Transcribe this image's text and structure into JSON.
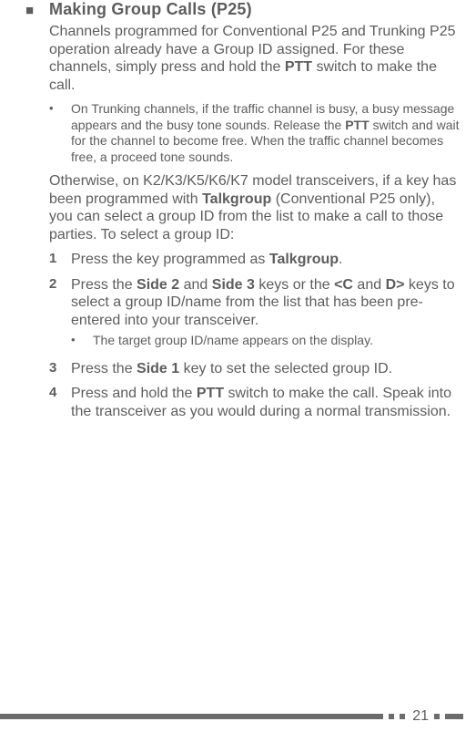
{
  "title": "Making Group Calls (P25)",
  "para1_a": "Channels programmed for Conventional P25 and Trunking P25 operation already have a Group ID assigned.  For these channels, simply press and hold the ",
  "para1_b": "PTT",
  "para1_c": " switch to make the call.",
  "bullet1_a": "On Trunking channels, if the traffic channel is busy, a busy message appears and the busy tone sounds.  Release the ",
  "bullet1_b": "PTT",
  "bullet1_c": " switch and wait for the channel to become free.  When the traffic channel becomes free, a proceed tone sounds.",
  "para2_a": "Otherwise, on K2/K3/K5/K6/K7 model transceivers, if a key has been programmed with ",
  "para2_b": "Talkgroup",
  "para2_c": " (Conventional P25 only), you can select a group ID from the list to make a call to those parties.  To select a group ID:",
  "step1_num": "1",
  "step1_a": "Press the key programmed as ",
  "step1_b": "Talkgroup",
  "step1_c": ".",
  "step2_num": "2",
  "step2_a": "Press the ",
  "step2_b": "Side 2",
  "step2_c": " and ",
  "step2_d": "Side 3",
  "step2_e": " keys or the ",
  "step2_f": "<C",
  "step2_g": " and ",
  "step2_h": "D>",
  "step2_i": " keys to select a group ID/name from the list that has been pre-entered into your transceiver.",
  "step2_sub": "The target group ID/name appears on the display.",
  "step3_num": "3",
  "step3_a": "Press the ",
  "step3_b": "Side 1",
  "step3_c": " key to set the selected group ID.",
  "step4_num": "4",
  "step4_a": "Press and hold the ",
  "step4_b": "PTT",
  "step4_c": " switch to make the call.  Speak into the transceiver as you would during a normal transmission.",
  "page_number": "21"
}
